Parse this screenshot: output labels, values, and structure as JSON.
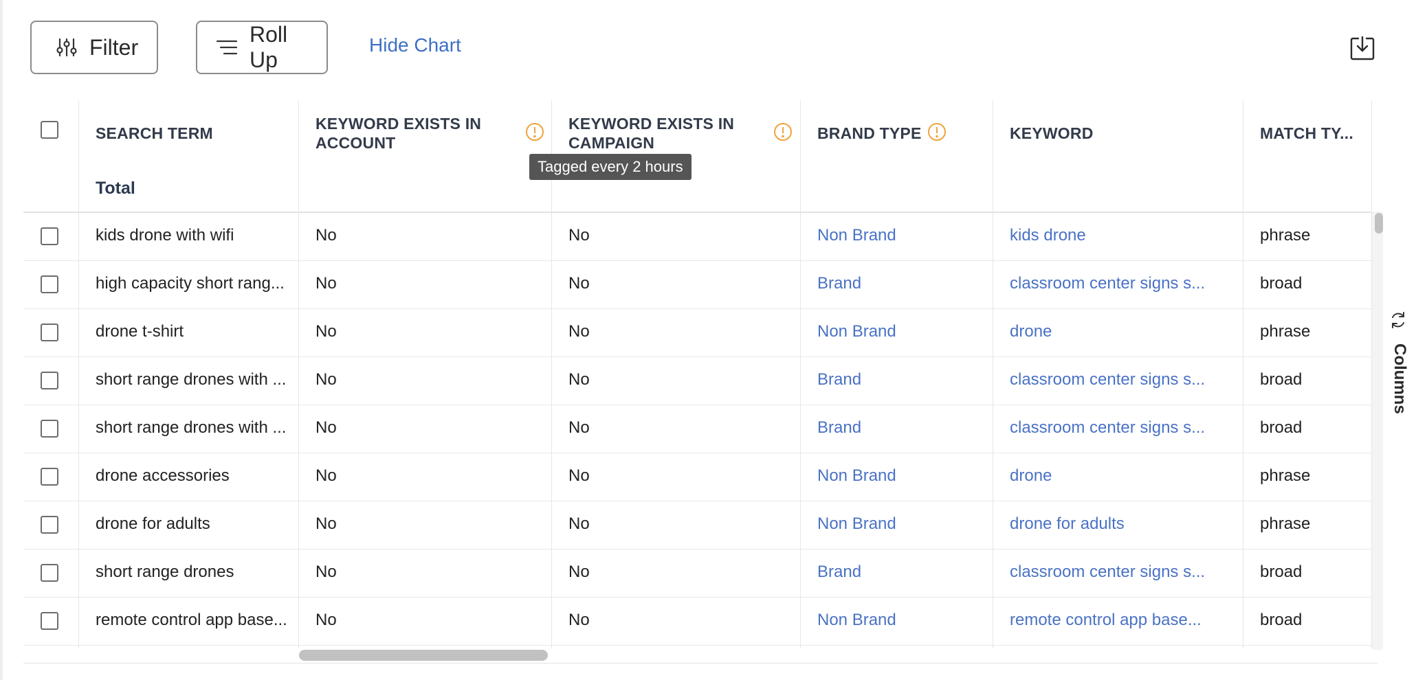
{
  "toolbar": {
    "filter_label": "Filter",
    "rollup_label": "Roll Up",
    "hide_chart_label": "Hide Chart",
    "export_icon": "download-icon"
  },
  "table": {
    "columns": [
      {
        "key": "search_term",
        "label": "SEARCH TERM"
      },
      {
        "key": "kw_account",
        "label": "KEYWORD EXISTS IN ACCOUNT",
        "info_icon": true
      },
      {
        "key": "kw_campaign",
        "label": "KEYWORD EXISTS IN CAMPAIGN",
        "info_icon": true
      },
      {
        "key": "brand_type",
        "label": "BRAND TYPE",
        "info_icon": true
      },
      {
        "key": "keyword",
        "label": "KEYWORD"
      },
      {
        "key": "match_type",
        "label": "MATCH TY..."
      }
    ],
    "total_label": "Total",
    "tooltip": "Tagged every 2 hours",
    "rows": [
      {
        "search_term": "kids drone with wifi",
        "kw_account": "No",
        "kw_campaign": "No",
        "brand_type": "Non Brand",
        "keyword": "kids drone",
        "match_type": "phrase"
      },
      {
        "search_term": "high capacity short rang...",
        "kw_account": "No",
        "kw_campaign": "No",
        "brand_type": "Brand",
        "keyword": "classroom center signs s...",
        "match_type": "broad"
      },
      {
        "search_term": "drone t-shirt",
        "kw_account": "No",
        "kw_campaign": "No",
        "brand_type": "Non Brand",
        "keyword": "drone",
        "match_type": "phrase"
      },
      {
        "search_term": "short range drones with ...",
        "kw_account": "No",
        "kw_campaign": "No",
        "brand_type": "Brand",
        "keyword": "classroom center signs s...",
        "match_type": "broad"
      },
      {
        "search_term": "short range drones with ...",
        "kw_account": "No",
        "kw_campaign": "No",
        "brand_type": "Brand",
        "keyword": "classroom center signs s...",
        "match_type": "broad"
      },
      {
        "search_term": "drone accessories",
        "kw_account": "No",
        "kw_campaign": "No",
        "brand_type": "Non Brand",
        "keyword": "drone",
        "match_type": "phrase"
      },
      {
        "search_term": "drone for adults",
        "kw_account": "No",
        "kw_campaign": "No",
        "brand_type": "Non Brand",
        "keyword": "drone for adults",
        "match_type": "phrase"
      },
      {
        "search_term": "short range drones",
        "kw_account": "No",
        "kw_campaign": "No",
        "brand_type": "Brand",
        "keyword": "classroom center signs s...",
        "match_type": "broad"
      },
      {
        "search_term": "remote control app base...",
        "kw_account": "No",
        "kw_campaign": "No",
        "brand_type": "Non Brand",
        "keyword": "remote control app base...",
        "match_type": "broad"
      }
    ]
  },
  "side_panel": {
    "columns_label": "Columns",
    "icon": "refresh-icon"
  },
  "colors": {
    "link": "#4a72c4",
    "warning": "#f0a33a",
    "header_text": "#333b4a"
  }
}
